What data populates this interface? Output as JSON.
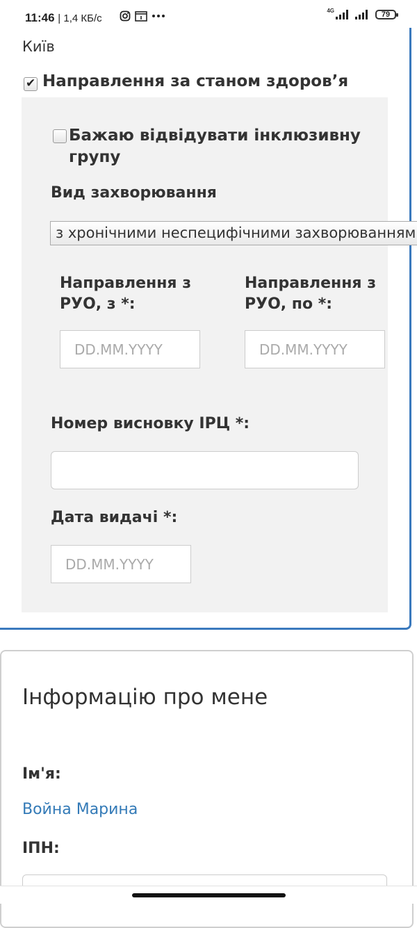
{
  "status_bar": {
    "time": "11:46",
    "speed": "| 1,4 КБ/с",
    "network_label": "4G",
    "battery": "79",
    "icons": [
      "instagram-icon",
      "notification-box-icon",
      "more-dots-icon",
      "signal-4g-icon",
      "signal-icon",
      "battery-icon"
    ]
  },
  "form": {
    "city": "Київ",
    "health_referral": {
      "label": "Направлення за станом здоров’я",
      "checked": true
    },
    "inclusive_group": {
      "label": "Бажаю відвідувати інклюзивну групу",
      "checked": false
    },
    "disease_type": {
      "label": "Вид захворювання",
      "selected": "з хронічними неспецифічними захворюваннями"
    },
    "ruo_from": {
      "label": "Направлення з РУО, з *:",
      "placeholder": "DD.MM.YYYY"
    },
    "ruo_to": {
      "label": "Направлення з РУО, по *:",
      "placeholder": "DD.MM.YYYY"
    },
    "irc_number": {
      "label": "Номер висновку ІРЦ *:",
      "value": ""
    },
    "issue_date": {
      "label": "Дата видачі *:",
      "placeholder": "DD.MM.YYYY"
    }
  },
  "about": {
    "title": "Інформацію про мене",
    "name_label": "Ім'я:",
    "name_value": "Война Марина",
    "ipn_label": "ІПН:"
  },
  "colors": {
    "accent": "#3a79bd",
    "link": "#337ab7",
    "panel": "#f2f2f2"
  }
}
